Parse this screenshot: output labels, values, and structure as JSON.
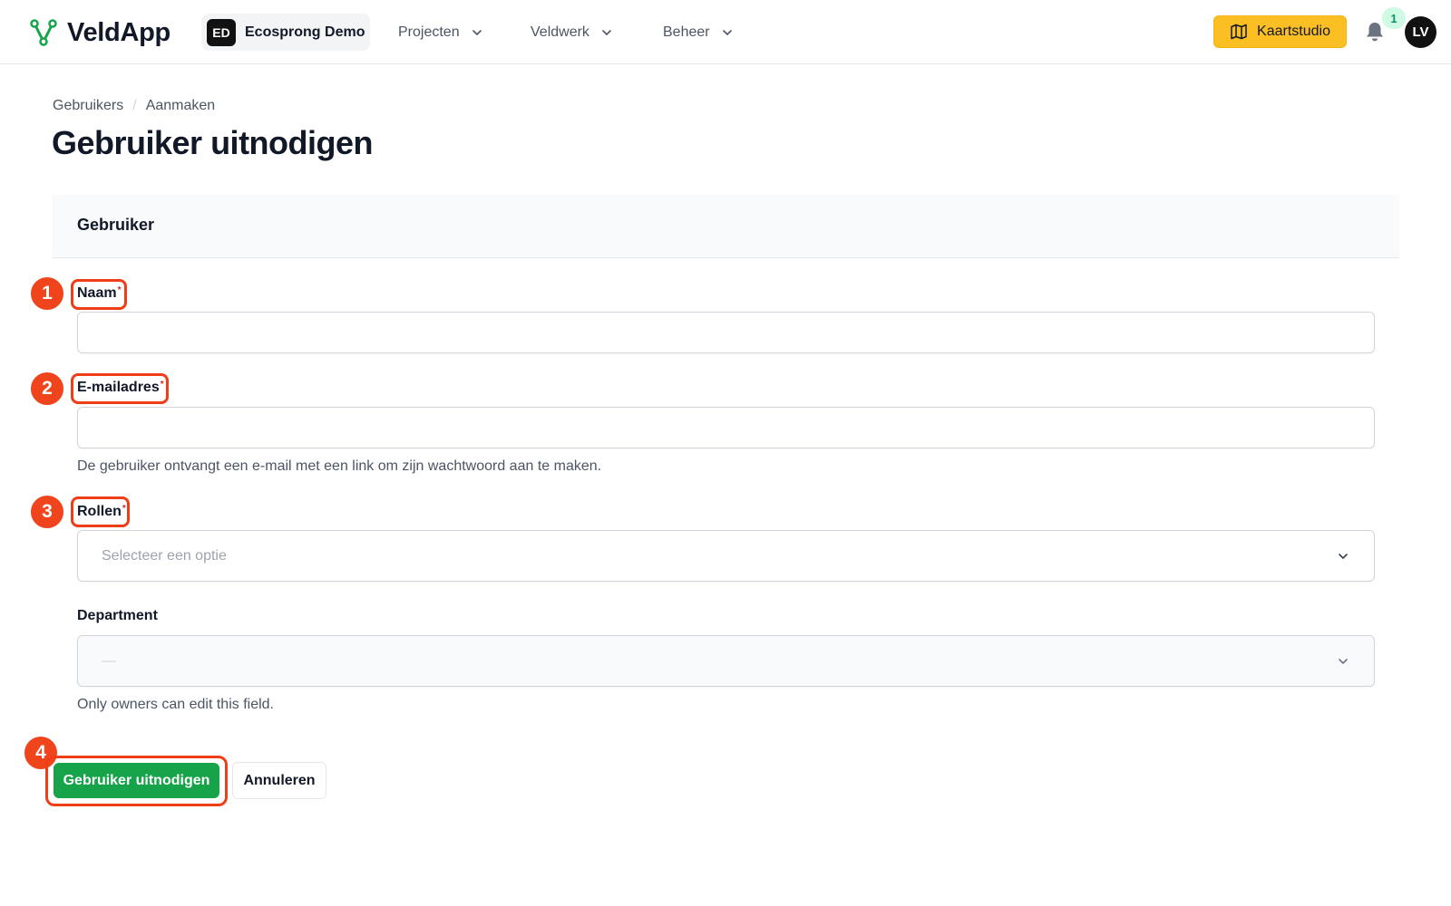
{
  "app": {
    "name": "VeldApp"
  },
  "workspace": {
    "initials": "ED",
    "name": "Ecosprong Demo"
  },
  "nav": {
    "items": [
      {
        "label": "Projecten"
      },
      {
        "label": "Veldwerk"
      },
      {
        "label": "Beheer"
      }
    ],
    "map_button": "Kaartstudio",
    "notification_count": "1",
    "avatar_initials": "LV"
  },
  "breadcrumb": {
    "parent": "Gebruikers",
    "separator": "/",
    "current": "Aanmaken"
  },
  "page": {
    "title": "Gebruiker uitnodigen"
  },
  "section": {
    "title": "Gebruiker"
  },
  "form": {
    "name": {
      "label": "Naam",
      "required_mark": "*",
      "value": "",
      "step": "1"
    },
    "email": {
      "label": "E-mailadres",
      "required_mark": "*",
      "value": "",
      "help": "De gebruiker ontvangt een e-mail met een link om zijn wachtwoord aan te maken.",
      "step": "2"
    },
    "roles": {
      "label": "Rollen",
      "required_mark": "*",
      "placeholder": "Selecteer een optie",
      "step": "3"
    },
    "department": {
      "label": "Department",
      "value": "—",
      "help": "Only owners can edit this field."
    }
  },
  "actions": {
    "submit": "Gebruiker uitnodigen",
    "cancel": "Annuleren",
    "step": "4"
  },
  "colors": {
    "primary": "#16a34a",
    "accent": "#fbbf24",
    "highlight": "#f0451c",
    "logo": "#16a34a"
  },
  "icons": {
    "logo": "branch-logo-icon",
    "chevron": "chevron-down-icon",
    "map": "map-icon",
    "bell": "bell-icon"
  }
}
